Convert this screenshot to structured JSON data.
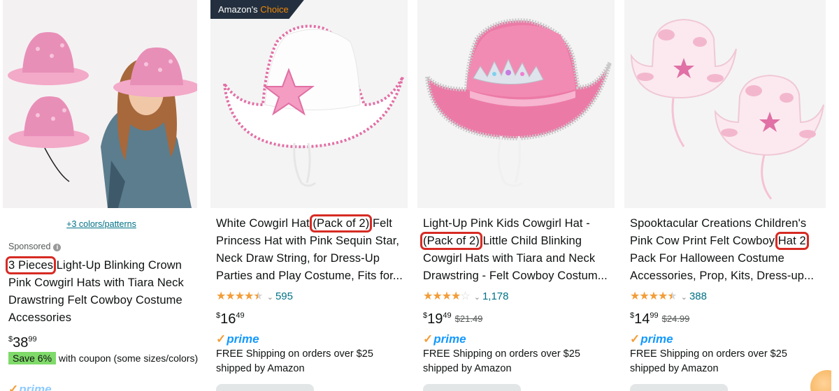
{
  "cards": [
    {
      "swatch_link": "+3 colors/patterns",
      "sponsored": "Sponsored",
      "title_highlight": "3 Pieces",
      "title_rest": " Light-Up Blinking Crown Pink Cowgirl Hats with Tiara Neck Drawstring Felt Cowboy Costume Accessories",
      "price_whole": "38",
      "price_frac": "99",
      "save_tag": "Save 6%",
      "save_text": " with coupon (some sizes/colors)",
      "prime": "prime"
    },
    {
      "badge_a": "Amazon's ",
      "badge_b": "Choice",
      "title_pre": "White Cowgirl Hat ",
      "title_highlight": "(Pack of 2)",
      "title_rest": " Felt Princess Hat with Pink Sequin Star, Neck Draw String, for Dress-Up Parties and Play Costume, Fits for...",
      "rating": 4.5,
      "reviews": "595",
      "price_whole": "16",
      "price_frac": "49",
      "prime": "prime",
      "shipping": "FREE Shipping on orders over $25",
      "shipped_by": "shipped by Amazon"
    },
    {
      "title_pre": "Light-Up Pink Kids Cowgirl Hat - ",
      "title_highlight": "(Pack of 2)",
      "title_rest": " Little Child Blinking Cowgirl Hats with Tiara and Neck Drawstring - Felt Cowboy Costum...",
      "rating": 4,
      "reviews": "1,178",
      "price_whole": "19",
      "price_frac": "49",
      "list_price": "$21.49",
      "prime": "prime",
      "shipping": "FREE Shipping on orders over $25",
      "shipped_by": "shipped by Amazon"
    },
    {
      "title_pre": "Spooktacular Creations Children's Pink Cow Print Felt Cowboy ",
      "title_highlight": "Hat 2",
      "title_rest": " Pack For Halloween Costume Accessories, Prop, Kits, Dress-up...",
      "rating": 4.5,
      "reviews": "388",
      "price_whole": "14",
      "price_frac": "99",
      "list_price": "$24.99",
      "prime": "prime",
      "shipping": "FREE Shipping on orders over $25",
      "shipped_by": "shipped by Amazon"
    }
  ],
  "currency": "$",
  "colors": {
    "link": "#007185",
    "star": "#f29d38",
    "highlight": "#d62b24",
    "prime": "#1399ff",
    "badge": "#232f3e"
  }
}
